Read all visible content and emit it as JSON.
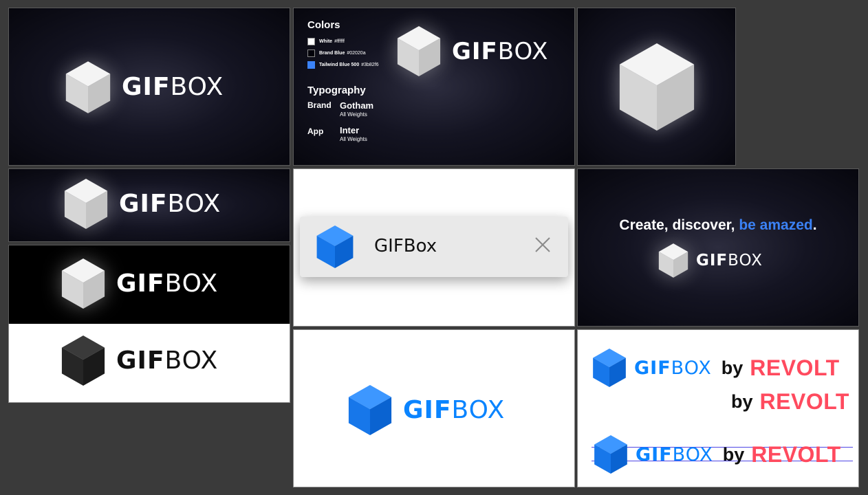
{
  "brand": {
    "wordmark_bold": "GIF",
    "wordmark_light": "BOX",
    "app_name": "GIFBox",
    "by_label": "by",
    "partner_name": "REVOLT"
  },
  "colors_section": {
    "heading": "Colors",
    "swatches": [
      {
        "name": "White",
        "hex": "#ffffff",
        "label_hex": "#ffffff"
      },
      {
        "name": "Brand Blue",
        "hex": "#02020a",
        "label_hex": "#02020a"
      },
      {
        "name": "Tailwind Blue 500",
        "hex": "#3b82f6",
        "label_hex": "#3b82f6"
      }
    ]
  },
  "typography_section": {
    "heading": "Typography",
    "rows": [
      {
        "role": "Brand",
        "font": "Gotham",
        "weights": "All Weights"
      },
      {
        "role": "App",
        "font": "Inter",
        "weights": "All Weights"
      }
    ]
  },
  "tagline": {
    "part1": "Create, discover, ",
    "accent": "be amazed",
    "end": "."
  },
  "palette": {
    "background": "#3a3a3a",
    "dark_bg": "#02020a",
    "brand_blue": "#0a84ff",
    "accent_blue": "#3b82f6",
    "revolt_red": "#ff4a5e",
    "cube_light": "#e8e8e8",
    "cube_dark": "#2e2e2e"
  },
  "icons": [
    "cube-logo-icon",
    "close-icon"
  ]
}
